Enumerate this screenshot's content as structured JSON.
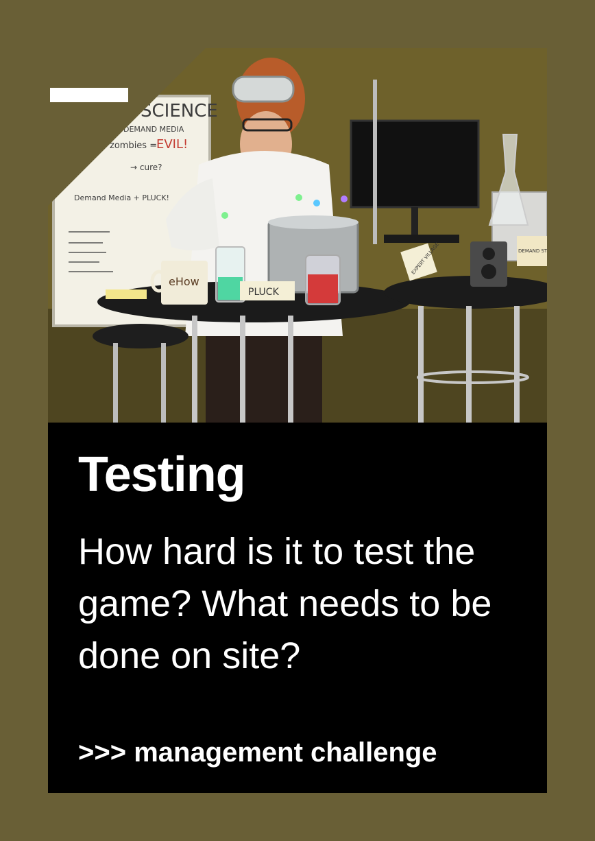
{
  "card": {
    "title": "Testing",
    "question": "How hard is it to test the game? What needs to be done on site?",
    "category": ">>> management challenge"
  },
  "photo": {
    "subject": "lab-scientist-photo",
    "whiteboard_heading": "SCIENCE",
    "whiteboard_line_1": "DEMAND MEDIA",
    "whiteboard_line_2": "zombies =",
    "whiteboard_evil": "EVIL!",
    "whiteboard_line_3": "→ cure?",
    "whiteboard_line_4": "Demand Media + PLUCK!",
    "mug_label": "eHow",
    "jar_label": "PLUCK",
    "card_label": "DEMAND STUDIOS",
    "tent_label": "EXPERT VILLAGE"
  },
  "colors": {
    "background": "#695f36",
    "panel": "#000000",
    "text": "#ffffff"
  }
}
